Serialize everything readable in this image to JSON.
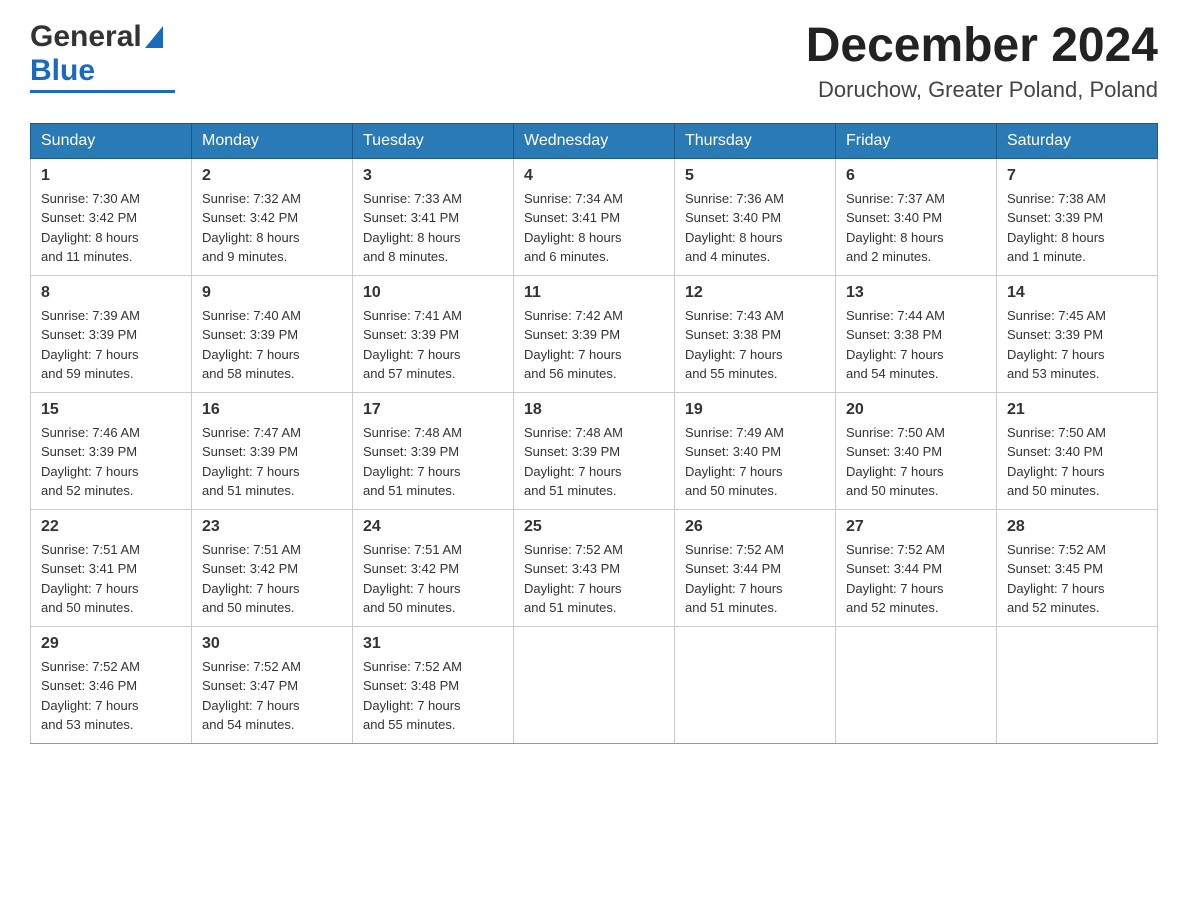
{
  "logo": {
    "general": "General",
    "blue": "Blue",
    "line_color": "#1a6bbf"
  },
  "header": {
    "month": "December 2024",
    "location": "Doruchow, Greater Poland, Poland"
  },
  "weekdays": [
    "Sunday",
    "Monday",
    "Tuesday",
    "Wednesday",
    "Thursday",
    "Friday",
    "Saturday"
  ],
  "weeks": [
    [
      {
        "day": "1",
        "sunrise": "Sunrise: 7:30 AM",
        "sunset": "Sunset: 3:42 PM",
        "daylight": "Daylight: 8 hours",
        "daylight2": "and 11 minutes."
      },
      {
        "day": "2",
        "sunrise": "Sunrise: 7:32 AM",
        "sunset": "Sunset: 3:42 PM",
        "daylight": "Daylight: 8 hours",
        "daylight2": "and 9 minutes."
      },
      {
        "day": "3",
        "sunrise": "Sunrise: 7:33 AM",
        "sunset": "Sunset: 3:41 PM",
        "daylight": "Daylight: 8 hours",
        "daylight2": "and 8 minutes."
      },
      {
        "day": "4",
        "sunrise": "Sunrise: 7:34 AM",
        "sunset": "Sunset: 3:41 PM",
        "daylight": "Daylight: 8 hours",
        "daylight2": "and 6 minutes."
      },
      {
        "day": "5",
        "sunrise": "Sunrise: 7:36 AM",
        "sunset": "Sunset: 3:40 PM",
        "daylight": "Daylight: 8 hours",
        "daylight2": "and 4 minutes."
      },
      {
        "day": "6",
        "sunrise": "Sunrise: 7:37 AM",
        "sunset": "Sunset: 3:40 PM",
        "daylight": "Daylight: 8 hours",
        "daylight2": "and 2 minutes."
      },
      {
        "day": "7",
        "sunrise": "Sunrise: 7:38 AM",
        "sunset": "Sunset: 3:39 PM",
        "daylight": "Daylight: 8 hours",
        "daylight2": "and 1 minute."
      }
    ],
    [
      {
        "day": "8",
        "sunrise": "Sunrise: 7:39 AM",
        "sunset": "Sunset: 3:39 PM",
        "daylight": "Daylight: 7 hours",
        "daylight2": "and 59 minutes."
      },
      {
        "day": "9",
        "sunrise": "Sunrise: 7:40 AM",
        "sunset": "Sunset: 3:39 PM",
        "daylight": "Daylight: 7 hours",
        "daylight2": "and 58 minutes."
      },
      {
        "day": "10",
        "sunrise": "Sunrise: 7:41 AM",
        "sunset": "Sunset: 3:39 PM",
        "daylight": "Daylight: 7 hours",
        "daylight2": "and 57 minutes."
      },
      {
        "day": "11",
        "sunrise": "Sunrise: 7:42 AM",
        "sunset": "Sunset: 3:39 PM",
        "daylight": "Daylight: 7 hours",
        "daylight2": "and 56 minutes."
      },
      {
        "day": "12",
        "sunrise": "Sunrise: 7:43 AM",
        "sunset": "Sunset: 3:38 PM",
        "daylight": "Daylight: 7 hours",
        "daylight2": "and 55 minutes."
      },
      {
        "day": "13",
        "sunrise": "Sunrise: 7:44 AM",
        "sunset": "Sunset: 3:38 PM",
        "daylight": "Daylight: 7 hours",
        "daylight2": "and 54 minutes."
      },
      {
        "day": "14",
        "sunrise": "Sunrise: 7:45 AM",
        "sunset": "Sunset: 3:39 PM",
        "daylight": "Daylight: 7 hours",
        "daylight2": "and 53 minutes."
      }
    ],
    [
      {
        "day": "15",
        "sunrise": "Sunrise: 7:46 AM",
        "sunset": "Sunset: 3:39 PM",
        "daylight": "Daylight: 7 hours",
        "daylight2": "and 52 minutes."
      },
      {
        "day": "16",
        "sunrise": "Sunrise: 7:47 AM",
        "sunset": "Sunset: 3:39 PM",
        "daylight": "Daylight: 7 hours",
        "daylight2": "and 51 minutes."
      },
      {
        "day": "17",
        "sunrise": "Sunrise: 7:48 AM",
        "sunset": "Sunset: 3:39 PM",
        "daylight": "Daylight: 7 hours",
        "daylight2": "and 51 minutes."
      },
      {
        "day": "18",
        "sunrise": "Sunrise: 7:48 AM",
        "sunset": "Sunset: 3:39 PM",
        "daylight": "Daylight: 7 hours",
        "daylight2": "and 51 minutes."
      },
      {
        "day": "19",
        "sunrise": "Sunrise: 7:49 AM",
        "sunset": "Sunset: 3:40 PM",
        "daylight": "Daylight: 7 hours",
        "daylight2": "and 50 minutes."
      },
      {
        "day": "20",
        "sunrise": "Sunrise: 7:50 AM",
        "sunset": "Sunset: 3:40 PM",
        "daylight": "Daylight: 7 hours",
        "daylight2": "and 50 minutes."
      },
      {
        "day": "21",
        "sunrise": "Sunrise: 7:50 AM",
        "sunset": "Sunset: 3:40 PM",
        "daylight": "Daylight: 7 hours",
        "daylight2": "and 50 minutes."
      }
    ],
    [
      {
        "day": "22",
        "sunrise": "Sunrise: 7:51 AM",
        "sunset": "Sunset: 3:41 PM",
        "daylight": "Daylight: 7 hours",
        "daylight2": "and 50 minutes."
      },
      {
        "day": "23",
        "sunrise": "Sunrise: 7:51 AM",
        "sunset": "Sunset: 3:42 PM",
        "daylight": "Daylight: 7 hours",
        "daylight2": "and 50 minutes."
      },
      {
        "day": "24",
        "sunrise": "Sunrise: 7:51 AM",
        "sunset": "Sunset: 3:42 PM",
        "daylight": "Daylight: 7 hours",
        "daylight2": "and 50 minutes."
      },
      {
        "day": "25",
        "sunrise": "Sunrise: 7:52 AM",
        "sunset": "Sunset: 3:43 PM",
        "daylight": "Daylight: 7 hours",
        "daylight2": "and 51 minutes."
      },
      {
        "day": "26",
        "sunrise": "Sunrise: 7:52 AM",
        "sunset": "Sunset: 3:44 PM",
        "daylight": "Daylight: 7 hours",
        "daylight2": "and 51 minutes."
      },
      {
        "day": "27",
        "sunrise": "Sunrise: 7:52 AM",
        "sunset": "Sunset: 3:44 PM",
        "daylight": "Daylight: 7 hours",
        "daylight2": "and 52 minutes."
      },
      {
        "day": "28",
        "sunrise": "Sunrise: 7:52 AM",
        "sunset": "Sunset: 3:45 PM",
        "daylight": "Daylight: 7 hours",
        "daylight2": "and 52 minutes."
      }
    ],
    [
      {
        "day": "29",
        "sunrise": "Sunrise: 7:52 AM",
        "sunset": "Sunset: 3:46 PM",
        "daylight": "Daylight: 7 hours",
        "daylight2": "and 53 minutes."
      },
      {
        "day": "30",
        "sunrise": "Sunrise: 7:52 AM",
        "sunset": "Sunset: 3:47 PM",
        "daylight": "Daylight: 7 hours",
        "daylight2": "and 54 minutes."
      },
      {
        "day": "31",
        "sunrise": "Sunrise: 7:52 AM",
        "sunset": "Sunset: 3:48 PM",
        "daylight": "Daylight: 7 hours",
        "daylight2": "and 55 minutes."
      },
      null,
      null,
      null,
      null
    ]
  ]
}
